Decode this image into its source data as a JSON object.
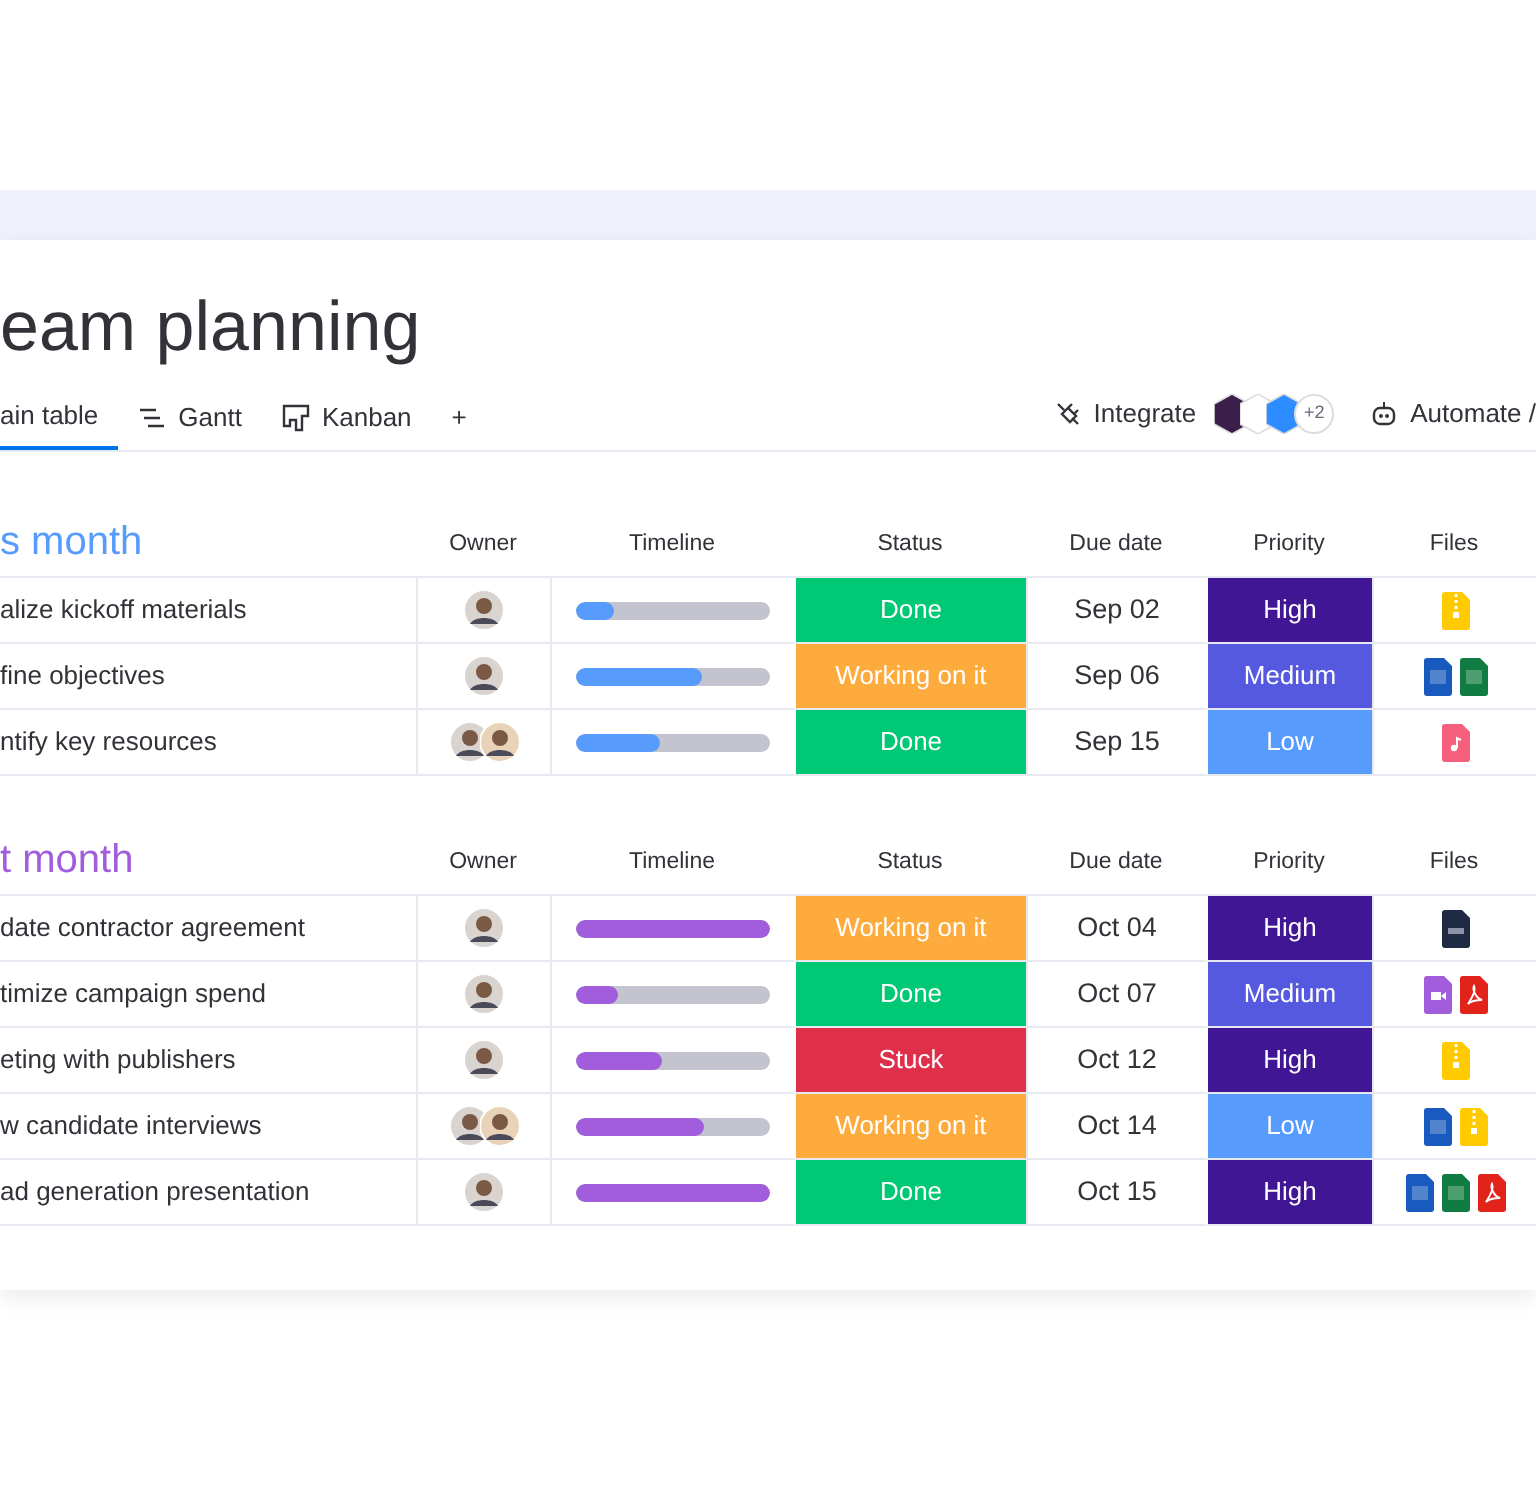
{
  "board": {
    "title": "eam planning"
  },
  "tabs": [
    {
      "label": "ain table",
      "kind": "plain",
      "selected": true
    },
    {
      "label": "Gantt",
      "kind": "gantt",
      "selected": false
    },
    {
      "label": "Kanban",
      "kind": "kanban",
      "selected": false
    },
    {
      "label": "+",
      "kind": "plain",
      "selected": false
    }
  ],
  "toolbar": {
    "integrate": "Integrate",
    "integrations_more": "+2",
    "automate": "Automate /"
  },
  "groups": [
    {
      "title": "s month",
      "color": "#579bfc",
      "columns": [
        "Owner",
        "Timeline",
        "Status",
        "Due date",
        "Priority",
        "Files"
      ],
      "rows": [
        {
          "task": "alize kickoff materials",
          "owners": [
            {
              "kind": "avatar"
            }
          ],
          "level": 0.2,
          "status": {
            "label": "Done",
            "color": "#00c875"
          },
          "due": "Sep 02",
          "priority": {
            "label": "High",
            "color": "#401694"
          },
          "files": [
            {
              "kind": "zip"
            }
          ]
        },
        {
          "task": "fine objectives",
          "owners": [
            {
              "kind": "avatar"
            }
          ],
          "level": 0.65,
          "status": {
            "label": "Working on it",
            "color": "#fdab3d"
          },
          "due": "Sep 06",
          "priority": {
            "label": "Medium",
            "color": "#5559df"
          },
          "files": [
            {
              "kind": "word"
            },
            {
              "kind": "excel"
            }
          ]
        },
        {
          "task": "ntify key resources",
          "owners": [
            {
              "kind": "avatar"
            },
            {
              "kind": "avatar"
            }
          ],
          "level": 0.43,
          "status": {
            "label": "Done",
            "color": "#00c875"
          },
          "due": "Sep 15",
          "priority": {
            "label": "Low",
            "color": "#579bfc"
          },
          "files": [
            {
              "kind": "audio"
            }
          ]
        }
      ]
    },
    {
      "title": "t month",
      "color": "#a25ddc",
      "columns": [
        "Owner",
        "Timeline",
        "Status",
        "Due date",
        "Priority",
        "Files"
      ],
      "rows": [
        {
          "task": "date contractor agreement",
          "owners": [
            {
              "kind": "avatar"
            }
          ],
          "level": 1,
          "status": {
            "label": "Working on it",
            "color": "#fdab3d"
          },
          "due": "Oct 04",
          "priority": {
            "label": "High",
            "color": "#401694"
          },
          "files": [
            {
              "kind": "image"
            }
          ]
        },
        {
          "task": "timize campaign spend",
          "owners": [
            {
              "kind": "avatar"
            }
          ],
          "level": 0.22,
          "status": {
            "label": "Done",
            "color": "#00c875"
          },
          "due": "Oct 07",
          "priority": {
            "label": "Medium",
            "color": "#5559df"
          },
          "files": [
            {
              "kind": "video"
            },
            {
              "kind": "pdf"
            }
          ]
        },
        {
          "task": "eting with publishers",
          "owners": [
            {
              "kind": "avatar"
            }
          ],
          "level": 0.44,
          "status": {
            "label": "Stuck",
            "color": "#df2f4a"
          },
          "due": "Oct 12",
          "priority": {
            "label": "High",
            "color": "#401694"
          },
          "files": [
            {
              "kind": "zip"
            }
          ]
        },
        {
          "task": "w candidate interviews",
          "owners": [
            {
              "kind": "avatar"
            },
            {
              "kind": "avatar"
            }
          ],
          "level": 0.66,
          "status": {
            "label": "Working on it",
            "color": "#fdab3d"
          },
          "due": "Oct 14",
          "priority": {
            "label": "Low",
            "color": "#579bfc"
          },
          "files": [
            {
              "kind": "word"
            },
            {
              "kind": "zip"
            }
          ]
        },
        {
          "task": "ad generation presentation",
          "owners": [
            {
              "kind": "avatar"
            }
          ],
          "level": 1,
          "status": {
            "label": "Done",
            "color": "#00c875"
          },
          "due": "Oct 15",
          "priority": {
            "label": "High",
            "color": "#401694"
          },
          "files": [
            {
              "kind": "word"
            },
            {
              "kind": "excel"
            },
            {
              "kind": "pdf"
            }
          ]
        }
      ]
    }
  ]
}
